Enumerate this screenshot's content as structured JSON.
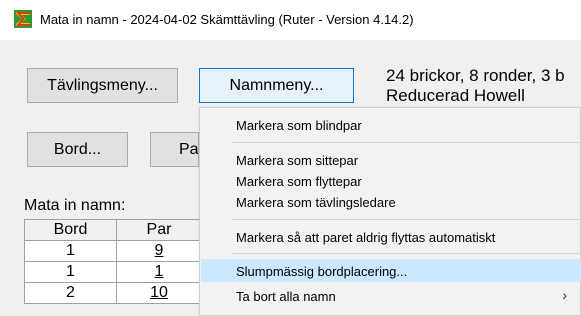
{
  "window": {
    "title": "Mata in namn - 2024-04-02  Skämttävling  (Ruter - Version 4.14.2)",
    "icon": "ruter-app-icon"
  },
  "toolbar": {
    "tavlingsmeny_label": "Tävlingsmeny...",
    "namnmeny_label": "Namnmeny...",
    "bord_label": "Bord...",
    "par_label": "Pa"
  },
  "info": {
    "line1": "24 brickor, 8 ronder, 3 b",
    "line2": "Reducerad Howell"
  },
  "names_section": {
    "label": "Mata in namn:",
    "columns": [
      "Bord",
      "Par"
    ],
    "rows": [
      {
        "bord": "1",
        "par": "9"
      },
      {
        "bord": "1",
        "par": "1"
      },
      {
        "bord": "2",
        "par": "10"
      }
    ]
  },
  "context_menu": {
    "items": [
      "Markera som blindpar",
      "Markera som sittepar",
      "Markera som flyttepar",
      "Markera som tävlingsledare",
      "Markera så att paret aldrig flyttas automatiskt",
      "Slumpmässig bordplacering...",
      "Ta bort alla namn"
    ],
    "submenu_arrow": "›",
    "highlight_color": "#cce8ff"
  }
}
